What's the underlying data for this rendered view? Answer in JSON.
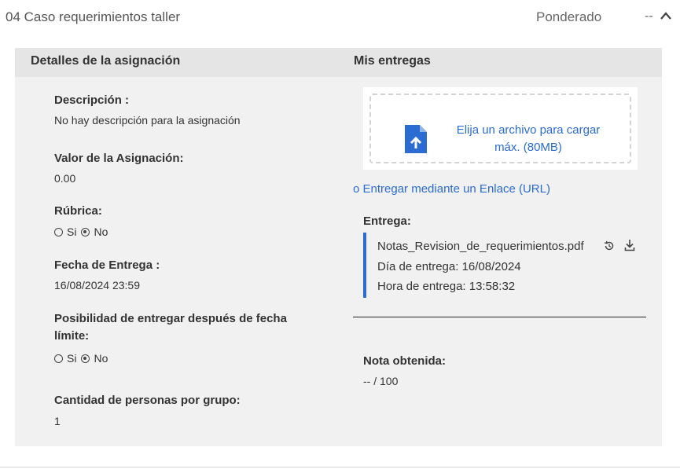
{
  "header": {
    "title": "04 Caso requerimientos taller",
    "weight": "Ponderado",
    "dash": "--"
  },
  "left": {
    "heading": "Detalles de la asignación",
    "descripcion_label": "Descripción :",
    "descripcion_value": "No hay descripción para la asignación",
    "valor_label": "Valor de la Asignación:",
    "valor_value": "0.00",
    "rubrica_label": "Rúbrica:",
    "rubrica_options": {
      "si": "Si",
      "no": "No",
      "selected": "No"
    },
    "fecha_label": "Fecha de Entrega :",
    "fecha_value": "16/08/2024 23:59",
    "posibilidad_label_1": "Posibilidad de entregar después de fecha",
    "posibilidad_label_2": "límite:",
    "posibilidad_options": {
      "si": "Si",
      "no": "No",
      "selected": "No"
    },
    "cantidad_label": "Cantidad de personas por grupo:",
    "cantidad_value": "1"
  },
  "right": {
    "heading": "Mis entregas",
    "upload_line1": "Elija un archivo para cargar",
    "upload_line2": "máx. (80MB)",
    "link_url": "o Entregar mediante un Enlace (URL)",
    "entrega_label": "Entrega:",
    "file_name": "Notas_Revision_de_requerimientos.pdf",
    "dia": "Día de entrega: 16/08/2024",
    "hora": "Hora de entrega: 13:58:32",
    "nota_label": "Nota obtenida:",
    "nota_value": "-- / 100"
  },
  "colors": {
    "accent": "#2b6cd3",
    "card_bg": "#f1f1f1",
    "card_head": "#e5e5e5"
  },
  "icons": [
    "chevron-up-icon",
    "file-upload-icon",
    "history-icon",
    "download-icon",
    "radio-icon"
  ]
}
